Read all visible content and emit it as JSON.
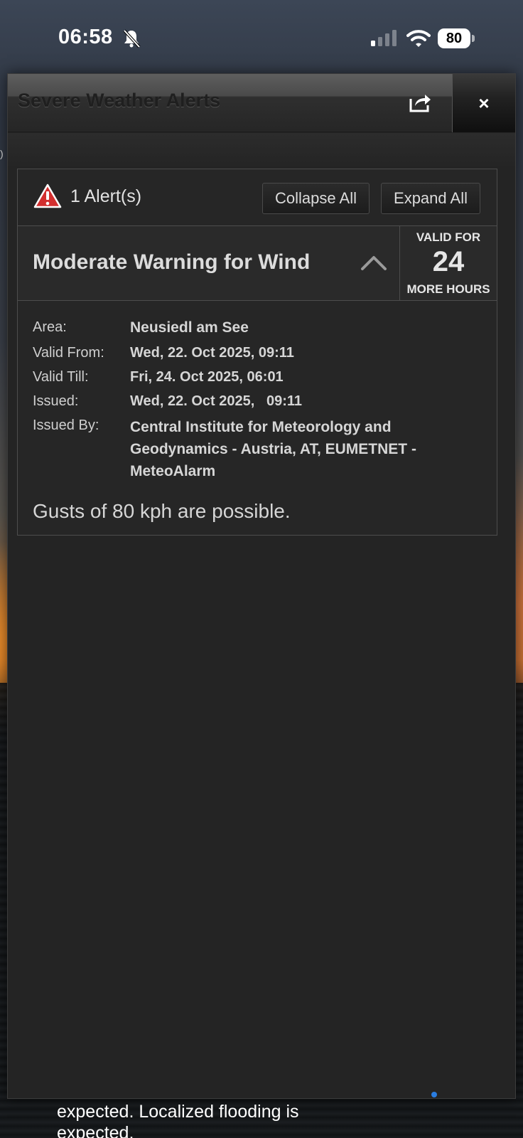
{
  "status_bar": {
    "time": "06:58",
    "battery": "80",
    "icons": [
      "bell-slash-icon",
      "cellular-signal-icon",
      "wifi-icon",
      "battery-icon"
    ]
  },
  "modal": {
    "title": "Severe Weather Alerts",
    "share_icon": "share-icon",
    "close_label": "×"
  },
  "summary": {
    "count_label": "1 Alert(s)",
    "collapse_all": "Collapse All",
    "expand_all": "Expand All",
    "warning_icon": "warning-triangle-icon",
    "warning_color": "#d32f2f"
  },
  "alert": {
    "title": "Moderate Warning for Wind",
    "expanded": true,
    "valid_for_top": "VALID FOR",
    "valid_for_hours": "24",
    "valid_for_bottom": "MORE HOURS",
    "fields": [
      {
        "label": "Area:",
        "value": "Neusiedl am See"
      },
      {
        "label": "Valid From:",
        "value": "Wed, 22. Oct 2025, 09:11"
      },
      {
        "label": "Valid Till:",
        "value": "Fri, 24. Oct 2025, 06:01"
      },
      {
        "label": "Issued:",
        "value": "Wed, 22. Oct 2025,   09:11"
      },
      {
        "label": "Issued By:",
        "value": "Central Institute for Meteorology and Geodynamics - Austria, AT, EUMETNET - MeteoAlarm"
      }
    ],
    "description": "Gusts of 80 kph are possible."
  },
  "background": {
    "peek_text": "expected.  Localized flooding is expected.",
    "left_edge_char": ")"
  }
}
